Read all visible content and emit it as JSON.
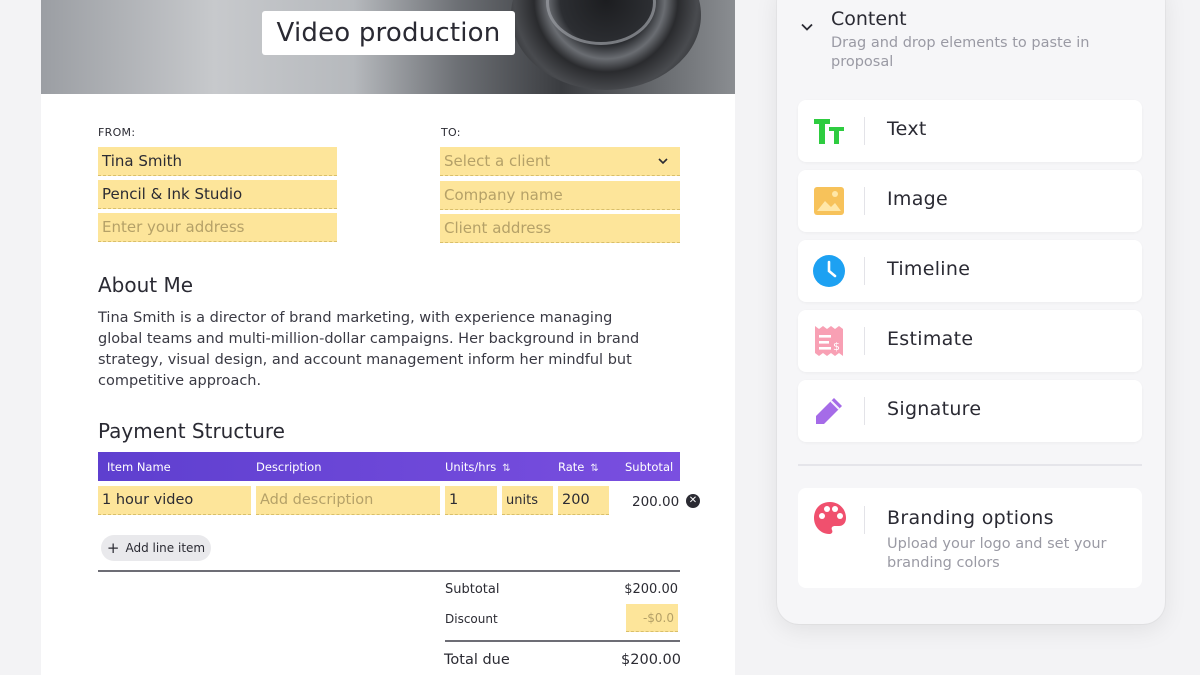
{
  "proposal": {
    "title": "Video production",
    "from_label": "FROM:",
    "to_label": "TO:",
    "from": {
      "name": "Tina Smith",
      "company": "Pencil & Ink Studio",
      "address_placeholder": "Enter your address"
    },
    "to": {
      "client_placeholder": "Select a client",
      "company_placeholder": "Company name",
      "address_placeholder": "Client address"
    },
    "about": {
      "heading": "About Me",
      "text": "Tina Smith is a director of brand marketing, with experience managing global teams and multi-million-dollar campaigns. Her background in brand strategy, visual design, and account management inform her mindful but competitive approach."
    },
    "payment": {
      "heading": "Payment Structure",
      "columns": {
        "item_name": "Item Name",
        "description": "Description",
        "units_hrs": "Units/hrs",
        "rate": "Rate",
        "subtotal": "Subtotal"
      },
      "rows": [
        {
          "item_name": "1 hour video",
          "description_placeholder": "Add description",
          "quantity": "1",
          "unit": "units",
          "rate": "200",
          "subtotal": "200.00"
        }
      ],
      "add_line_label": "Add line item",
      "totals": {
        "subtotal_label": "Subtotal",
        "subtotal_value": "$200.00",
        "discount_label": "Discount",
        "discount_value": "-$0.0",
        "total_label": "Total due",
        "total_value": "$200.00"
      }
    }
  },
  "content_panel": {
    "title": "Content",
    "subtitle": "Drag and drop elements to paste in proposal",
    "items": [
      {
        "label": "Text",
        "icon": "text-icon",
        "color": "#2ecc40"
      },
      {
        "label": "Image",
        "icon": "image-icon",
        "color": "#f7c25a"
      },
      {
        "label": "Timeline",
        "icon": "clock-icon",
        "color": "#1da1f2"
      },
      {
        "label": "Estimate",
        "icon": "receipt-icon",
        "color": "#f36b8a"
      },
      {
        "label": "Signature",
        "icon": "pencil-icon",
        "color": "#a56be8"
      }
    ],
    "branding": {
      "label": "Branding options",
      "subtitle": "Upload your logo and set your branding colors",
      "icon": "palette-icon",
      "color": "#f0506e"
    }
  },
  "colors": {
    "field_fill": "#fde59a",
    "table_header": "#6a47d8",
    "accent_purple": "#7a4fe0"
  }
}
